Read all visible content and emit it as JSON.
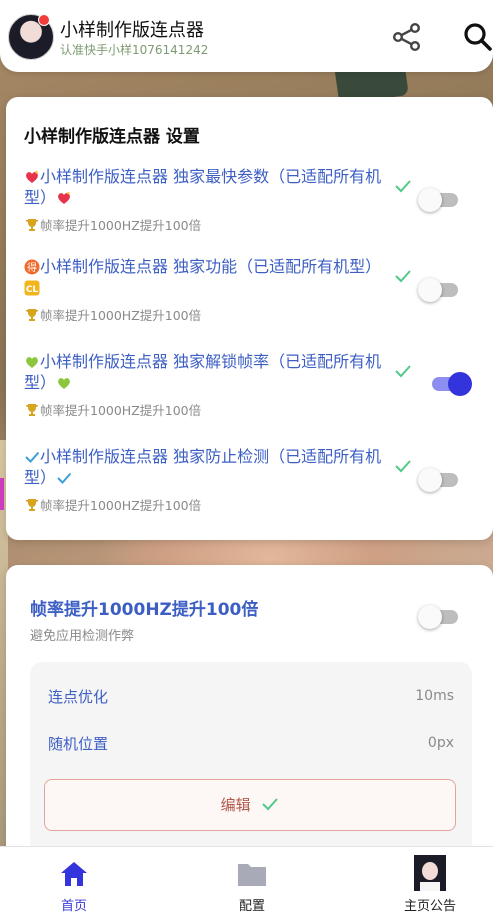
{
  "header": {
    "title": "小样制作版连点器",
    "subtitle": "认准快手小样1076141242",
    "share_icon": "share-icon",
    "search_icon": "search-icon"
  },
  "settings": {
    "title": "小样制作版连点器 设置",
    "items": [
      {
        "icon": "sparkling-heart-icon",
        "title": "小样制作版连点器 独家最快参数（已适配所有机型）",
        "trail_icon": "sparkling-heart-icon",
        "sub": "帧率提升1000HZ提升100倍",
        "checked": true,
        "enabled": false
      },
      {
        "icon": "deal-badge-icon",
        "title": "小样制作版连点器 独家功能（已适配所有机型）",
        "trail_icon": "cl-badge-icon",
        "sub": "帧率提升1000HZ提升100倍",
        "checked": true,
        "enabled": false
      },
      {
        "icon": "green-heart-icon",
        "title": "小样制作版连点器 独家解锁帧率（已适配所有机型）",
        "trail_icon": "green-heart-icon",
        "sub": "帧率提升1000HZ提升100倍",
        "checked": true,
        "enabled": true
      },
      {
        "icon": "check-mark-icon",
        "title": "小样制作版连点器 独家防止检测（已适配所有机型）",
        "trail_icon": "check-mark-icon",
        "sub": "帧率提升1000HZ提升100倍",
        "checked": true,
        "enabled": false
      }
    ]
  },
  "boost": {
    "title": "帧率提升1000HZ提升100倍",
    "subtitle": "避免应用检测作弊",
    "enabled": false,
    "rows": [
      {
        "label": "连点优化",
        "value": "10ms"
      },
      {
        "label": "随机位置",
        "value": "0px"
      }
    ],
    "edit_label": "编辑"
  },
  "nav": {
    "items": [
      {
        "label": "首页",
        "icon": "home-icon",
        "active": true
      },
      {
        "label": "配置",
        "icon": "folder-icon",
        "active": false
      },
      {
        "label": "主页公告",
        "icon": "avatar-icon",
        "active": false
      }
    ]
  },
  "colors": {
    "accent": "#3434dc",
    "title_blue": "#3d5fc4",
    "check_green": "#52c98a",
    "edit_border": "#e4a49c"
  }
}
